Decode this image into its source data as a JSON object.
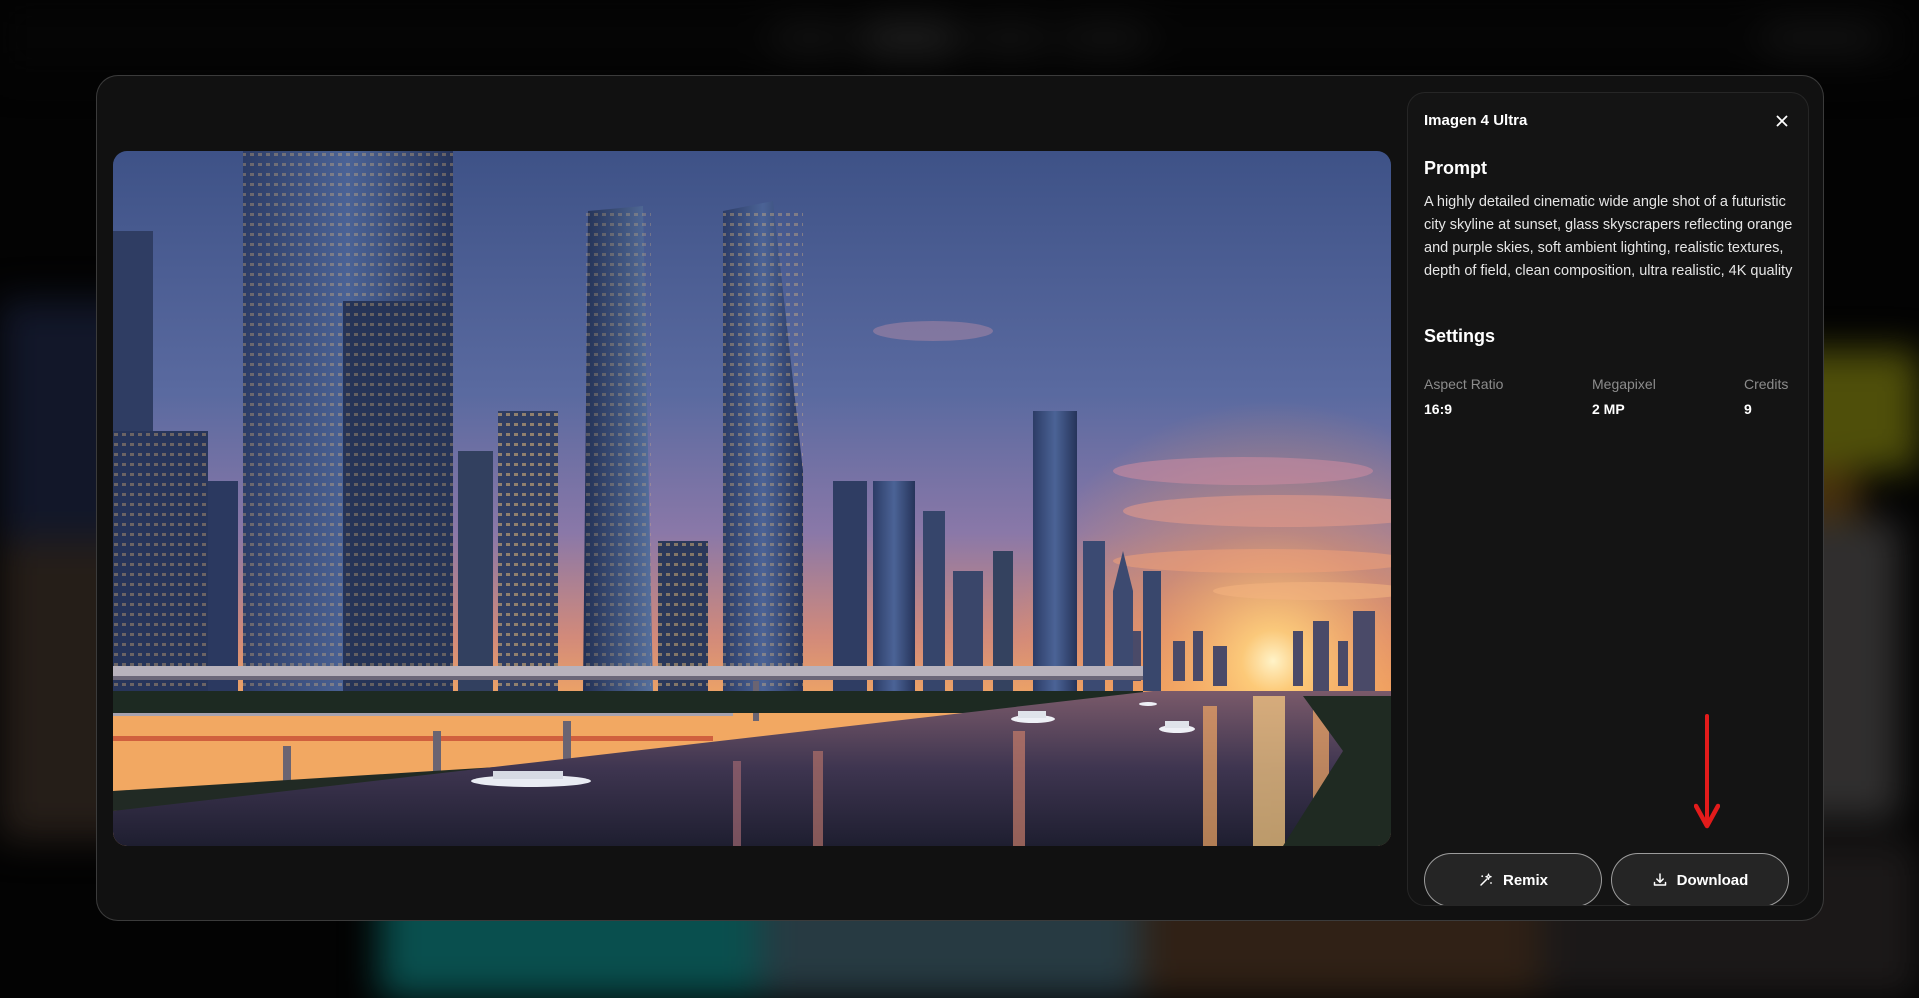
{
  "modal": {
    "title": "Imagen 4 Ultra",
    "prompt_heading": "Prompt",
    "prompt_text": "A highly detailed cinematic wide angle shot of a futuristic city skyline at sunset, glass skyscrapers reflecting orange and purple skies, soft ambient lighting, realistic textures, depth of field, clean composition, ultra realistic, 4K quality",
    "settings_heading": "Settings",
    "settings": [
      {
        "label": "Aspect Ratio",
        "value": "16:9"
      },
      {
        "label": "Megapixel",
        "value": "2 MP"
      },
      {
        "label": "Credits",
        "value": "9"
      }
    ],
    "buttons": {
      "remix_label": "Remix",
      "download_label": "Download"
    }
  },
  "icons": {
    "close": "close-icon",
    "remix": "sparkle-icon",
    "download": "download-icon",
    "annotation": "red-arrow-down-icon"
  },
  "colors": {
    "modal_bg": "#111111",
    "annotation_arrow": "#e31b1b"
  }
}
